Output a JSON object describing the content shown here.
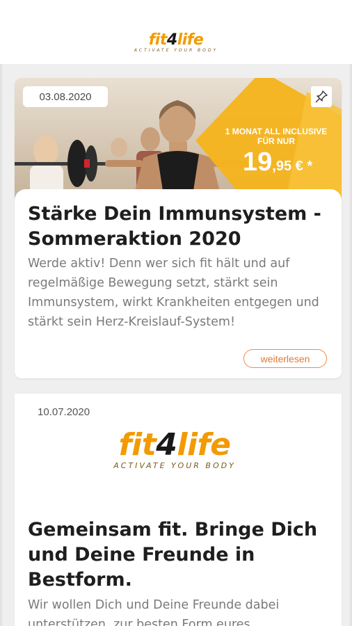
{
  "header": {
    "logo_text_a": "fit",
    "logo_text_four": "4",
    "logo_text_b": "life",
    "logo_tagline": "ACTIVATE YOUR BODY"
  },
  "posts": [
    {
      "date": "03.08.2020",
      "pin_icon": "pin-icon",
      "promo_line1": "1 MONAT ALL INCLUSIVE",
      "promo_line2": "FÜR NUR",
      "promo_price_main": "19",
      "promo_price_rest": ",95 € *",
      "title": "Stärke Dein Immunsystem - Sommeraktion 2020",
      "excerpt": "Werde aktiv! Denn wer sich fit hält und auf regelmäßige Bewegung setzt, stärkt sein Immunsystem, wirkt Krankheiten entgegen und stärkt sein Herz-Kreislauf-System!",
      "read_more": "weiterlesen"
    },
    {
      "date": "10.07.2020",
      "logo_text_a": "fit",
      "logo_text_four": "4",
      "logo_text_b": "life",
      "logo_tagline": "ACTIVATE YOUR BODY",
      "title": "Gemeinsam fit. Bringe Dich und Deine Freunde in Bestform.",
      "excerpt": "Wir wollen Dich und Deine Freunde dabei unterstützen, zur besten Form eures"
    }
  ],
  "colors": {
    "brand_orange": "#f29a00",
    "button_orange": "#f08a4b",
    "promo_yellow": "#f5b41e"
  }
}
